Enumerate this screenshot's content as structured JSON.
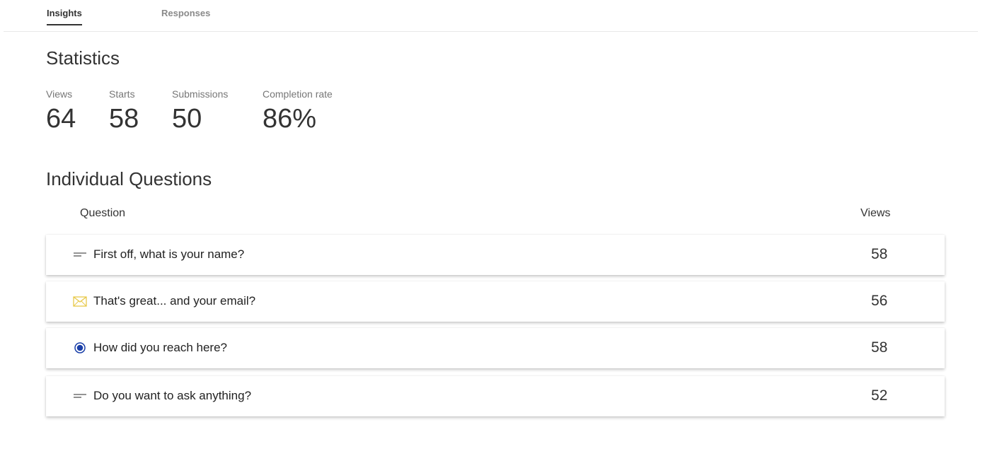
{
  "tabs": [
    {
      "label": "Insights",
      "active": true
    },
    {
      "label": "Responses",
      "active": false
    }
  ],
  "statistics": {
    "title": "Statistics",
    "items": [
      {
        "label": "Views",
        "value": "64"
      },
      {
        "label": "Starts",
        "value": "58"
      },
      {
        "label": "Submissions",
        "value": "50"
      },
      {
        "label": "Completion rate",
        "value": "86%"
      }
    ]
  },
  "questions": {
    "title": "Individual Questions",
    "columns": {
      "question": "Question",
      "views": "Views"
    },
    "rows": [
      {
        "icon": "short-text-icon",
        "text": "First off, what is your name?",
        "views": "58"
      },
      {
        "icon": "envelope-icon",
        "text": "That's great... and your email?",
        "views": "56"
      },
      {
        "icon": "radio-button-icon",
        "text": "How did you reach here?",
        "views": "58"
      },
      {
        "icon": "short-text-icon",
        "text": "Do you want to ask anything?",
        "views": "52"
      }
    ]
  },
  "colors": {
    "envelope_icon": "#e8c94a",
    "radio_icon": "#1a3fa8",
    "tab_active": "#333333",
    "tab_inactive": "#8a8a8a"
  }
}
